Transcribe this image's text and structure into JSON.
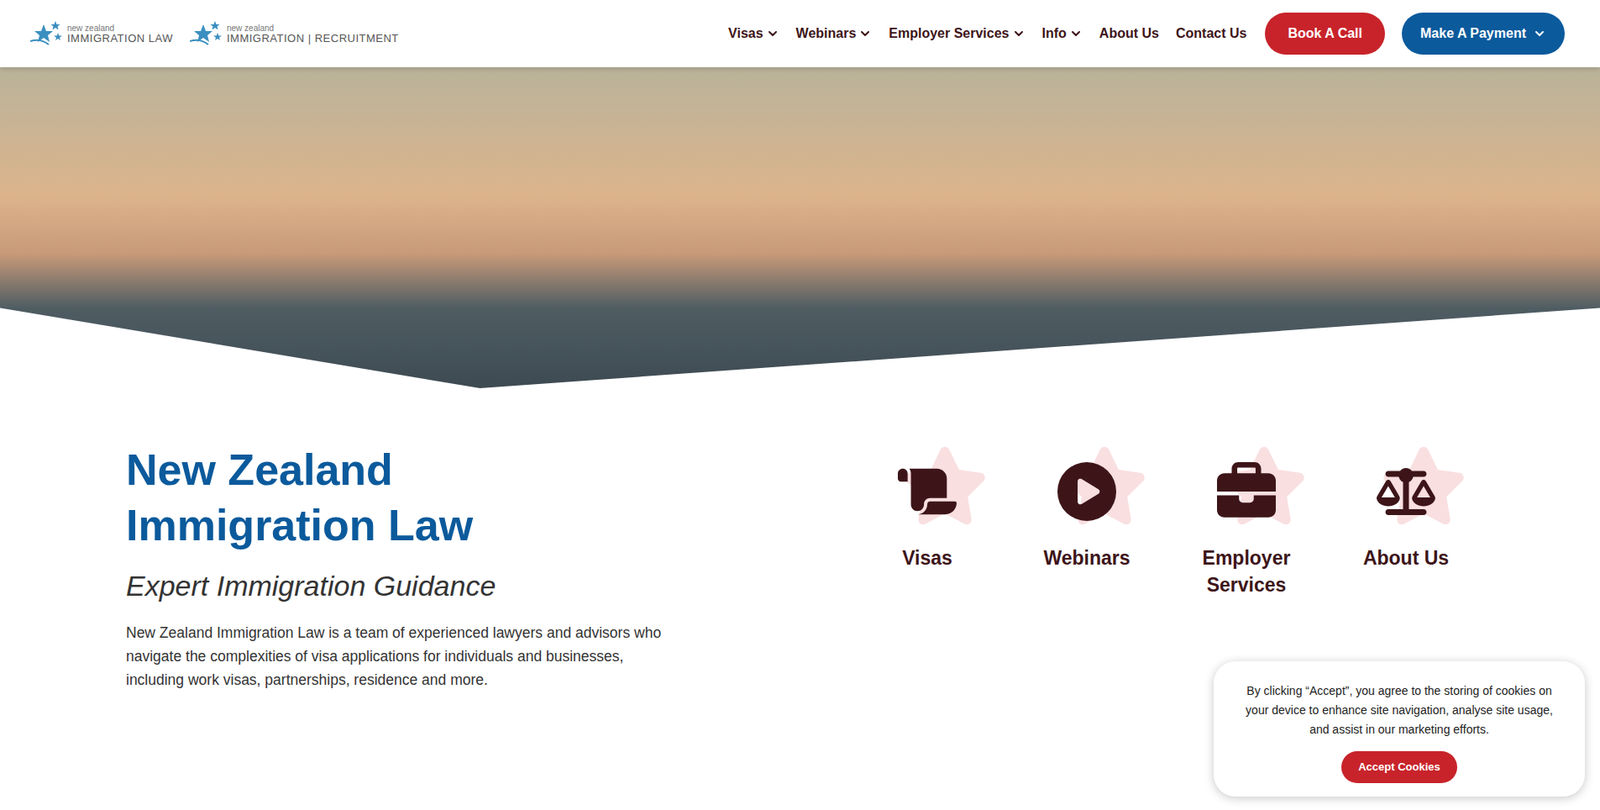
{
  "header": {
    "logos": [
      {
        "small": "new zealand",
        "main": "IMMIGRATION LAW"
      },
      {
        "small": "new zealand",
        "main": "IMMIGRATION | RECRUITMENT"
      }
    ],
    "nav": [
      {
        "label": "Visas",
        "dropdown": true
      },
      {
        "label": "Webinars",
        "dropdown": true
      },
      {
        "label": "Employer Services",
        "dropdown": true
      },
      {
        "label": "Info",
        "dropdown": true
      },
      {
        "label": "About Us",
        "dropdown": false
      },
      {
        "label": "Contact Us",
        "dropdown": false
      }
    ],
    "book_button": "Book A Call",
    "payment_button": {
      "label": "Make A Payment",
      "dropdown": true
    }
  },
  "intro": {
    "title": "New Zealand Immigration Law",
    "subtitle": "Expert Immigration Guidance",
    "description": "New Zealand Immigration Law is a team of experienced lawyers and advisors who navigate the complexities of visa applications for individuals and businesses, including work visas, partnerships, residence and more."
  },
  "tiles": [
    {
      "label": "Visas"
    },
    {
      "label": "Webinars"
    },
    {
      "label": "Employer Services"
    },
    {
      "label": "About Us"
    }
  ],
  "cookie_banner": {
    "text": "By clicking “Accept”, you agree to the storing of cookies on your device to enhance site navigation, analyse site usage, and assist in our marketing efforts.",
    "button": "Accept Cookies"
  }
}
